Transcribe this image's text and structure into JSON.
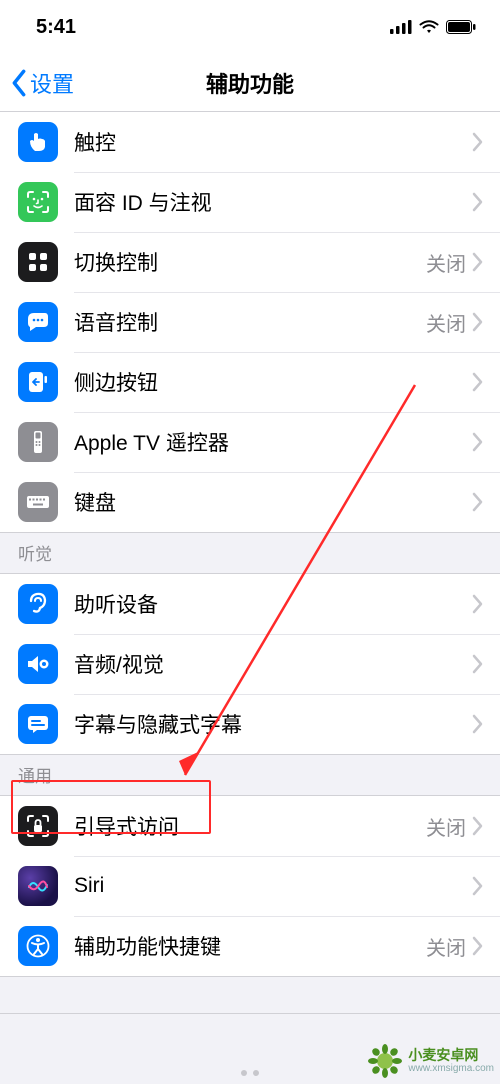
{
  "status": {
    "time": "5:41"
  },
  "nav": {
    "back": "设置",
    "title": "辅助功能"
  },
  "sections": [
    {
      "header": null,
      "rows": [
        {
          "icon": "touch",
          "label": "触控",
          "value": null
        },
        {
          "icon": "faceid",
          "label": "面容 ID 与注视",
          "value": null
        },
        {
          "icon": "switch",
          "label": "切换控制",
          "value": "关闭"
        },
        {
          "icon": "voice",
          "label": "语音控制",
          "value": "关闭"
        },
        {
          "icon": "sidebutton",
          "label": "侧边按钮",
          "value": null
        },
        {
          "icon": "appletv",
          "label": "Apple TV 遥控器",
          "value": null
        },
        {
          "icon": "keyboard",
          "label": "键盘",
          "value": null
        }
      ]
    },
    {
      "header": "听觉",
      "rows": [
        {
          "icon": "hearing",
          "label": "助听设备",
          "value": null
        },
        {
          "icon": "audiovisual",
          "label": "音频/视觉",
          "value": null
        },
        {
          "icon": "subtitles",
          "label": "字幕与隐藏式字幕",
          "value": null
        }
      ]
    },
    {
      "header": "通用",
      "rows": [
        {
          "icon": "guided",
          "label": "引导式访问",
          "value": "关闭"
        },
        {
          "icon": "siri",
          "label": "Siri",
          "value": null
        },
        {
          "icon": "shortcut",
          "label": "辅助功能快捷键",
          "value": "关闭"
        }
      ]
    }
  ],
  "watermark": {
    "site": "www.xmsigma.com",
    "brand": "小麦安卓网"
  }
}
